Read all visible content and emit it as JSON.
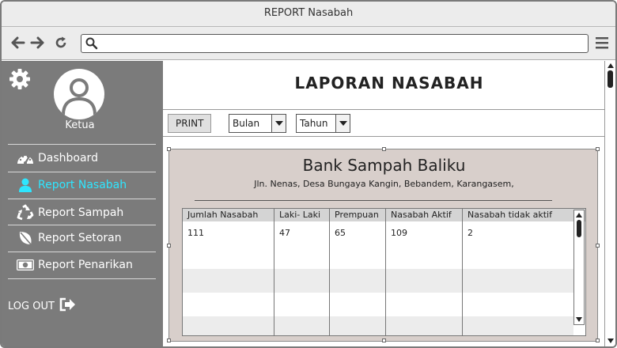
{
  "window": {
    "title": "REPORT Nasabah"
  },
  "browser": {
    "back_icon": "arrow-left-icon",
    "forward_icon": "arrow-right-icon",
    "reload_icon": "reload-icon",
    "search_icon": "search-icon",
    "menu_icon": "hamburger-menu-icon",
    "url": ""
  },
  "sidebar": {
    "user_role": "Ketua",
    "items": [
      {
        "label": "Dashboard",
        "icon": "dashboard-gauge-icon",
        "active": false
      },
      {
        "label": "Report  Nasabah",
        "icon": "user-icon",
        "active": true
      },
      {
        "label": "Report Sampah",
        "icon": "recycle-icon",
        "active": false
      },
      {
        "label": "Report Setoran",
        "icon": "leaf-icon",
        "active": false
      },
      {
        "label": "Report Penarikan",
        "icon": "money-icon",
        "active": false
      }
    ],
    "logout_label": "LOG OUT",
    "active_color": "#2ee6ff",
    "background_color": "#7b7b7b"
  },
  "main": {
    "page_title": "LAPORAN NASABAH",
    "print_label": "PRINT",
    "month_select": "Bulan",
    "year_select": "Tahun"
  },
  "report": {
    "bank_name": "Bank Sampah Baliku",
    "address": "Jln. Nenas, Desa Bungaya Kangin, Bebandem, Karangasem,",
    "panel_color": "#d8cfcb",
    "columns": [
      "Jumlah Nasabah",
      "Laki- Laki",
      "Prempuan",
      "Nasabah Aktif",
      "Nasabah tidak aktif"
    ],
    "rows": [
      [
        "111",
        "47",
        "65",
        "109",
        "2"
      ],
      [
        "",
        "",
        "",
        "",
        ""
      ],
      [
        "",
        "",
        "",
        "",
        ""
      ],
      [
        "",
        "",
        "",
        "",
        ""
      ],
      [
        "",
        "",
        "",
        "",
        ""
      ]
    ]
  }
}
